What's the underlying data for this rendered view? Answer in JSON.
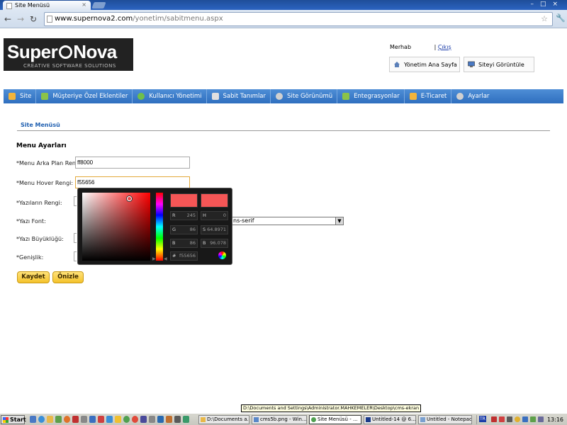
{
  "browser": {
    "tab_title": "Site Menüsü",
    "tab_close": "×",
    "window_controls": "–□×",
    "url_domain": "www.supernova2.com",
    "url_path": "/yonetim/sabitmenu.aspx",
    "star_icon": "☆",
    "wrench_icon": "🔧"
  },
  "logo": {
    "word_left": "Super",
    "word_right": "Nova",
    "tagline": "CREATIVE SOFTWARE SOLUTIONS"
  },
  "header": {
    "greeting": "Merhab",
    "separator": " | ",
    "logout": "Çıkış",
    "admin_home": "Yönetim Ana Sayfa",
    "view_site": "Siteyi Görüntüle"
  },
  "menu": {
    "items": [
      {
        "label": "Site",
        "icon": "star-folder-icon",
        "color": "#f2b43a"
      },
      {
        "label": "Müşteriye Özel Eklentiler",
        "icon": "plugin-icon",
        "color": "#8bc34a"
      },
      {
        "label": "Kullanıcı Yönetimi",
        "icon": "user-icon",
        "color": "#6fbf4a"
      },
      {
        "label": "Sabit Tanımlar",
        "icon": "document-icon",
        "color": "#e0e0e0"
      },
      {
        "label": "Site Görünümü",
        "icon": "gear-icon",
        "color": "#d0d0d0"
      },
      {
        "label": "Entegrasyonlar",
        "icon": "plugin-icon",
        "color": "#8bc34a"
      },
      {
        "label": "E-Ticaret",
        "icon": "star-folder-icon",
        "color": "#f2b43a"
      },
      {
        "label": "Ayarlar",
        "icon": "gear-icon",
        "color": "#d0d0d0"
      }
    ]
  },
  "breadcrumb": "Site Menüsü",
  "form": {
    "section_title": "Menu Ayarları",
    "bg_label": "*Menu Arka Plan Rengi:",
    "bg_value": "ff8000",
    "hover_label": "*Menu Hover Rengi:",
    "hover_value": "f55656",
    "text_color_label": "*Yazıların Rengi:",
    "font_label": "*Yazı Font:",
    "font_value": "ns-serif",
    "font_size_label": "*Yazı Büyüklüğü:",
    "width_label": "*Genişlik:",
    "save_button": "Kaydet",
    "preview_button": "Önizle"
  },
  "color_picker": {
    "color": "#f55656",
    "r_label": "R",
    "r_value": "245",
    "g_label": "G",
    "g_value": "86",
    "b_label": "B",
    "b_value": "86",
    "h_label": "H",
    "h_value": "0",
    "s_label": "S",
    "s_value": "64.8971",
    "b2_label": "B",
    "b2_value": "96.078",
    "hex_label": "#",
    "hex_value": "f55656"
  },
  "taskbar": {
    "start": "Start",
    "tooltip": "D:\\Documents and Settings\\Administrator.MAHKEMELER\\Desktop\\cms-ekran",
    "tasks": [
      {
        "label": "D:\\Documents a..."
      },
      {
        "label": "cms5b.png - Win..."
      },
      {
        "label": "Site Menüsü - ..."
      },
      {
        "label": "Untitled-14 @ 6..."
      },
      {
        "label": "Untitled - Notepad"
      }
    ],
    "lang": "TR",
    "clock": "13:16"
  }
}
